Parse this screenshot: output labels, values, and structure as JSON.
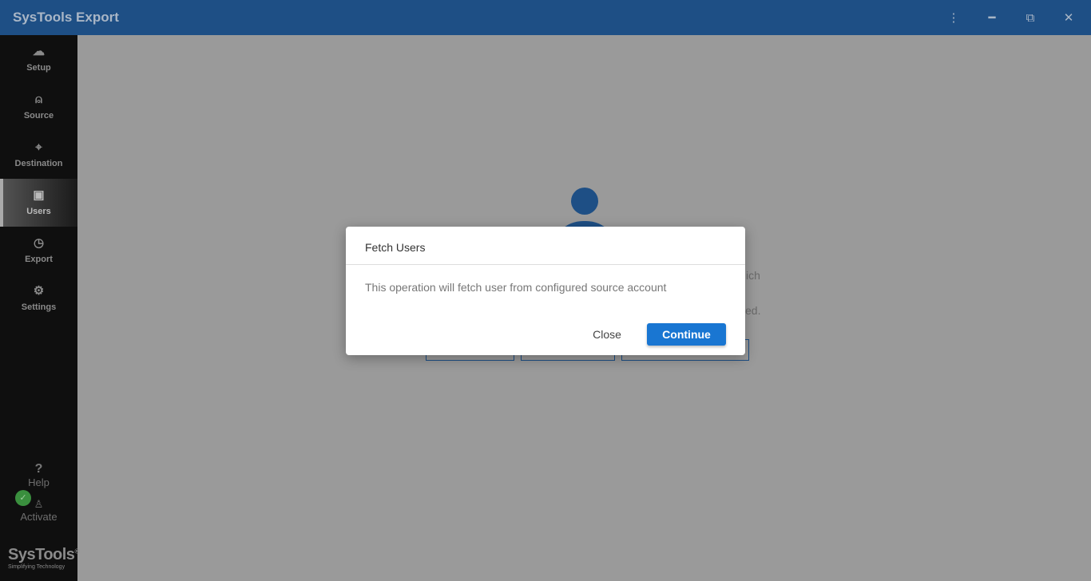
{
  "window": {
    "title": "SysTools Export",
    "menu_icon": "more-vertical-icon",
    "minimize_icon": "minimize-icon",
    "restore_icon": "restore-icon",
    "close_icon": "close-icon"
  },
  "sidebar": {
    "items": [
      {
        "label": "Setup",
        "icon": "☁"
      },
      {
        "label": "Source",
        "icon": "⍝"
      },
      {
        "label": "Destination",
        "icon": "⌖"
      },
      {
        "label": "Users",
        "icon": "▣",
        "active": true
      },
      {
        "label": "Export",
        "icon": "◷"
      },
      {
        "label": "Settings",
        "icon": "⚙"
      }
    ],
    "help": "Help",
    "help_icon": "?",
    "activate": "Activate",
    "activate_icon": "♙",
    "logo": "SysTools",
    "logo_reg": "®",
    "logo_tagline": "Simplifying Technology"
  },
  "background": {
    "fragment_1": "ich",
    "fragment_2": "ed."
  },
  "dialog": {
    "title": "Fetch Users",
    "message": "This operation will fetch user from configured source account",
    "close": "Close",
    "continue": "Continue"
  },
  "colors": {
    "titlebar": "#1e4f85",
    "primary": "#1976d2",
    "sidebar": "#0f0f0f"
  }
}
